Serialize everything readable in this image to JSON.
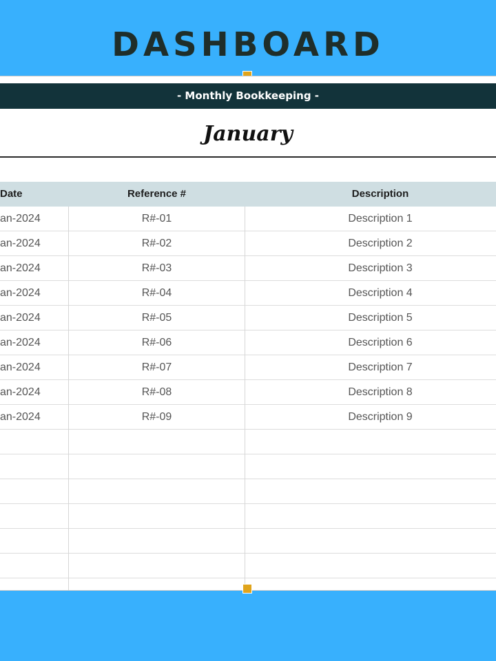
{
  "banner": {
    "title": "DASHBOARD"
  },
  "sheet": {
    "subheader": "- Monthly Bookkeeping -",
    "month": "January"
  },
  "table": {
    "columns": {
      "date": "Date",
      "reference": "Reference #",
      "description": "Description"
    },
    "rows": [
      {
        "date": "an-2024",
        "reference": "R#-01",
        "description": "Description 1"
      },
      {
        "date": "an-2024",
        "reference": "R#-02",
        "description": "Description 2"
      },
      {
        "date": "an-2024",
        "reference": "R#-03",
        "description": "Description 3"
      },
      {
        "date": "an-2024",
        "reference": "R#-04",
        "description": "Description 4"
      },
      {
        "date": "an-2024",
        "reference": "R#-05",
        "description": "Description 5"
      },
      {
        "date": "an-2024",
        "reference": "R#-06",
        "description": "Description 6"
      },
      {
        "date": "an-2024",
        "reference": "R#-07",
        "description": "Description 7"
      },
      {
        "date": "an-2024",
        "reference": "R#-08",
        "description": "Description 8"
      },
      {
        "date": "an-2024",
        "reference": "R#-09",
        "description": "Description 9"
      },
      {
        "date": "",
        "reference": "",
        "description": ""
      },
      {
        "date": "",
        "reference": "",
        "description": ""
      },
      {
        "date": "",
        "reference": "",
        "description": ""
      },
      {
        "date": "",
        "reference": "",
        "description": ""
      },
      {
        "date": "",
        "reference": "",
        "description": ""
      },
      {
        "date": "",
        "reference": "",
        "description": ""
      },
      {
        "date": "",
        "reference": "",
        "description": ""
      }
    ]
  },
  "colors": {
    "background": "#38b0fd",
    "header_bar": "#12333a",
    "table_header": "#cfdee2",
    "handle": "#e0a41c",
    "title_text": "#1f2e2a"
  }
}
